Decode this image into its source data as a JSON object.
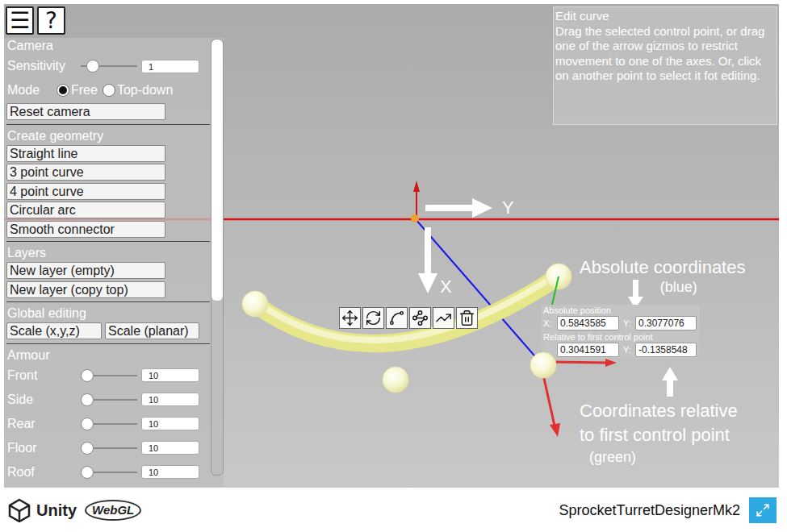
{
  "top_buttons": [
    "☰",
    "?"
  ],
  "left_panel": {
    "sections": [
      {
        "title": "Camera",
        "items": [
          {
            "kind": "slider",
            "label": "Sensitivity",
            "level": 0.13,
            "value": "1"
          },
          {
            "kind": "radio",
            "label": "Mode",
            "options": [
              {
                "label": "Free",
                "selected": true
              },
              {
                "label": "Top-down",
                "selected": false
              }
            ]
          },
          {
            "kind": "button",
            "label": "Reset camera"
          }
        ]
      },
      {
        "title": "Create geometry",
        "items": [
          {
            "kind": "button",
            "label": "Straight line"
          },
          {
            "kind": "button",
            "label": "3 point curve"
          },
          {
            "kind": "button",
            "label": "4 point curve"
          },
          {
            "kind": "button",
            "label": "Circular arc"
          },
          {
            "kind": "button",
            "label": "Smooth connector"
          }
        ]
      },
      {
        "title": "Layers",
        "items": [
          {
            "kind": "button",
            "label": "New layer (empty)"
          },
          {
            "kind": "button",
            "label": "New layer (copy top)"
          }
        ]
      },
      {
        "title": "Global editing",
        "items": [
          {
            "kind": "button-row",
            "buttons": [
              "Scale (x,y,z)",
              "Scale (planar)"
            ]
          }
        ]
      },
      {
        "title": "Armour",
        "items": [
          {
            "kind": "slider",
            "label": "Front",
            "level": 0,
            "value": "10"
          },
          {
            "kind": "slider",
            "label": "Side",
            "level": 0,
            "value": "10"
          },
          {
            "kind": "slider",
            "label": "Rear",
            "level": 0,
            "value": "10"
          },
          {
            "kind": "slider",
            "label": "Floor",
            "level": 0,
            "value": "10"
          },
          {
            "kind": "slider",
            "label": "Roof",
            "level": 0,
            "value": "10"
          }
        ]
      }
    ],
    "scrollbar": {
      "level": 0.6
    }
  },
  "info_panel": {
    "title": "Edit curve",
    "text": "Drag the selected control point, or drag one of the arrow gizmos to restrict movement to one of the axes. Or, click on another point to select it fot editing."
  },
  "gizmo": {
    "y_label": "Y",
    "x_label": "X"
  },
  "coordinates": {
    "absolute_label": "Absolute position",
    "x_label": "X:",
    "absolute_x": "0.5843585",
    "y_label": "Y:",
    "absolute_y": "0.3077076",
    "relative_label": "Relative to first control point",
    "relative_x": "0.3041591",
    "relative_y_label": "Y:",
    "relative_y": "-0.1358548"
  },
  "annotations": {
    "absolute": {
      "title": "Absolute coordinates",
      "note": "(blue)"
    },
    "relative": {
      "lines": [
        "Coordinates relative",
        "to first control point"
      ],
      "note": "(green)"
    }
  },
  "footer": {
    "brand": "Unity",
    "badge": "WebGL",
    "title": "SprocketTurretDesignerMk2"
  }
}
